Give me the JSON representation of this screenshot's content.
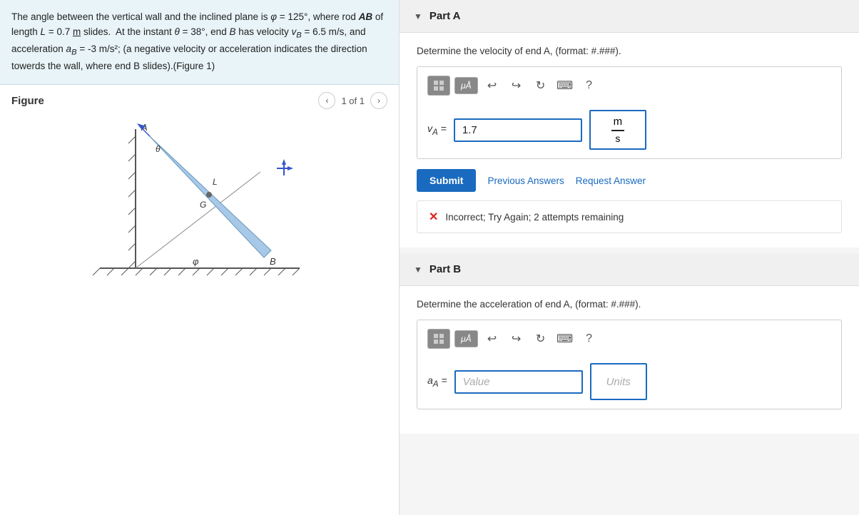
{
  "left": {
    "problem_text_lines": [
      "The angle between the vertical wall and the inclined plane is φ = 125°,",
      "where rod AB of length L = 0.7 m slides.  At the instant θ = 38°, end",
      "B has velocity v_B = 6.5 m/s, and acceleration a_B = -3 m/s²; (a",
      "negative velocity or acceleration indicates the direction towerds the",
      "wall, where end B slides).(Figure 1)"
    ],
    "figure_title": "Figure",
    "figure_nav": {
      "prev_label": "<",
      "count_label": "1 of 1",
      "next_label": ">"
    }
  },
  "right": {
    "part_a": {
      "header_label": "Part A",
      "description": "Determine the velocity of end A, (format: #.###).",
      "toolbar": {
        "matrix_btn": "⊞",
        "mu_btn": "μÅ",
        "undo_icon": "↩",
        "redo_icon": "↪",
        "refresh_icon": "↻",
        "keyboard_icon": "⌨",
        "help_icon": "?"
      },
      "input_label": "v_A =",
      "input_value": "1.7",
      "input_placeholder": "",
      "units_numerator": "m",
      "units_denominator": "s",
      "submit_label": "Submit",
      "prev_answers_label": "Previous Answers",
      "request_answer_label": "Request Answer",
      "error_message": "Incorrect; Try Again; 2 attempts remaining"
    },
    "part_b": {
      "header_label": "Part B",
      "description": "Determine the acceleration of end A, (format: #.###).",
      "toolbar": {
        "matrix_btn": "⊞",
        "mu_btn": "μÅ",
        "undo_icon": "↩",
        "redo_icon": "↪",
        "refresh_icon": "↻",
        "keyboard_icon": "⌨",
        "help_icon": "?"
      },
      "input_label": "a_A =",
      "input_placeholder": "Value",
      "units_placeholder": "Units"
    }
  }
}
